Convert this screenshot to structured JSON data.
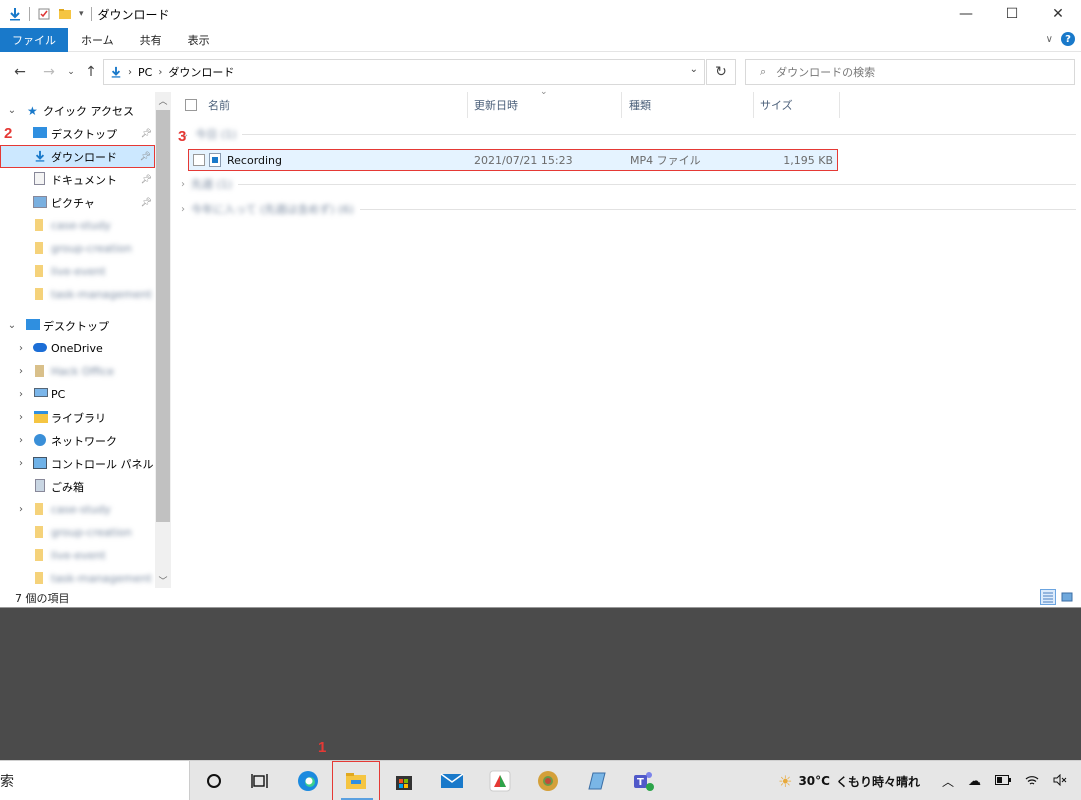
{
  "window": {
    "title": "ダウンロード",
    "controls": {
      "minimize": "—",
      "maximize": "☐",
      "close": "✕"
    }
  },
  "ribbon": {
    "tabs": [
      "ファイル",
      "ホーム",
      "共有",
      "表示"
    ]
  },
  "address": {
    "path": [
      "PC",
      "ダウンロード"
    ],
    "search_placeholder": "ダウンロードの検索"
  },
  "nav": {
    "quick_access": "クイック アクセス",
    "quick_items": [
      "デスクトップ",
      "ダウンロード",
      "ドキュメント",
      "ピクチャ"
    ],
    "quick_folders": [
      "case-study",
      "group-creation",
      "live-event",
      "task-management"
    ],
    "desktop": "デスクトップ",
    "desktop_items": [
      "OneDrive",
      "Hack Office",
      "PC",
      "ライブラリ",
      "ネットワーク",
      "コントロール パネル",
      "ごみ箱"
    ],
    "desktop_folders": [
      "case-study",
      "group-creation",
      "live-event",
      "task-management"
    ]
  },
  "columns": {
    "name": "名前",
    "date": "更新日時",
    "type": "種類",
    "size": "サイズ"
  },
  "groups": [
    "今日 (1)",
    "先週 (1)",
    "今年に入って (先週は含めず) (6)"
  ],
  "file": {
    "name": "Recording",
    "date": "2021/07/21 15:23",
    "type": "MP4 ファイル",
    "size": "1,195 KB"
  },
  "status": {
    "count": "7 個の項目"
  },
  "markers": {
    "one": "1",
    "two": "2",
    "three": "3"
  },
  "taskbar": {
    "search_text": "索",
    "temperature": "30°C",
    "weather": "くもり時々晴れ"
  },
  "colors": {
    "accent": "#1979ca",
    "highlight": "#e53935",
    "selection": "#cce8ff"
  }
}
